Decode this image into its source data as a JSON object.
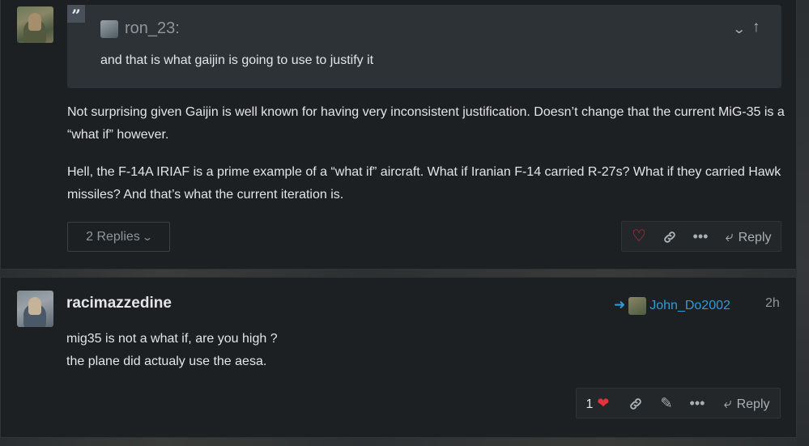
{
  "colors": {
    "background": "#24282a",
    "post_background": "#1c2023",
    "quote_background": "#2c3236",
    "like_red": "#e2343a",
    "link_blue": "#2f9bd6",
    "text": "#e3e5e7",
    "muted_text": "#8f969b"
  },
  "post1": {
    "quote": {
      "quote_mark": "”",
      "author": "ron_23:",
      "text": "and that is what gaijin is going to use to justify it",
      "collapse_icon": "chevron-down-icon",
      "jump_icon": "arrow-up-icon"
    },
    "paragraphs": [
      "Not surprising given Gaijin is well known for having very inconsistent justification. Doesn’t change that the current MiG-35 is a “what if” however.",
      "Hell, the F-14A IRIAF is a prime example of a “what if” aircraft. What if Iranian F-14 carried R-27s? What if they carried Hawk missiles? And that’s what the current iteration is."
    ],
    "replies_button": "2 Replies",
    "actions": {
      "like_icon": "heart-outline-icon",
      "link_icon": "link-icon",
      "more_icon": "ellipsis-icon",
      "reply_label": "Reply"
    }
  },
  "post2": {
    "username": "racimazzedine",
    "reply_to": "John_Do2002",
    "time": "2h",
    "lines": [
      "mig35 is not a what if, are you high ?",
      "the plane did actualy use the aesa."
    ],
    "actions": {
      "like_count": "1",
      "like_icon": "heart-filled-icon",
      "link_icon": "link-icon",
      "edit_icon": "pencil-icon",
      "more_icon": "ellipsis-icon",
      "reply_label": "Reply"
    }
  }
}
